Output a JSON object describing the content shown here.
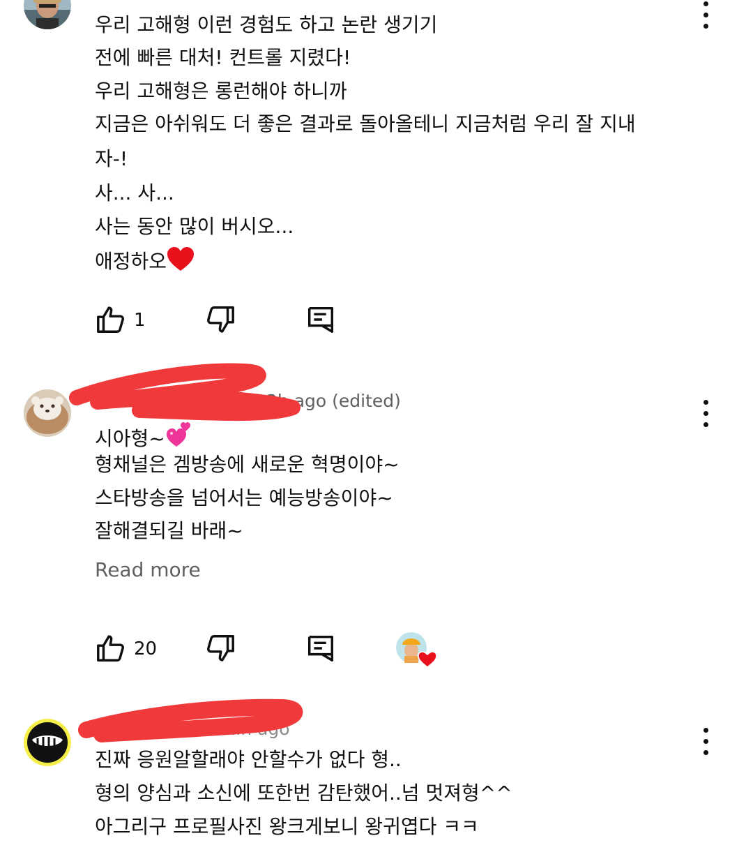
{
  "comments": [
    {
      "meta": "",
      "lines": [
        "우리 고해형 이런 경험도 하고 논란 생기기",
        "전에 빠른 대처! 컨트롤 지렸다!",
        "우리 고해형은 롱런해야 하니까",
        "지금은 아쉬워도 더 좋은 결과로 돌아올테니 지금처럼 우리 잘 지내",
        "자-!",
        "사... 사...",
        "사는 동안 많이 버시오...",
        "애정하오"
      ],
      "likes": "1"
    },
    {
      "meta": "2h ago (edited)",
      "lines": [
        "시아형~",
        "형채널은 겜방송에 새로운 혁명이야~",
        "스타방송을 넘어서는 예능방송이야~",
        "잘해결되길 바래~"
      ],
      "read_more": "Read more",
      "likes": "20"
    },
    {
      "meta": "min ago",
      "lines": [
        "진짜 응원알할래야 안할수가 없다 형..",
        "형의 양심과 소신에 또한번 감탄했어..넘 멋져형^^",
        "아그리구 프로필사진 왕크게보니 왕귀엽다 ㅋㅋ"
      ]
    }
  ],
  "icons": {
    "like": "thumbs-up-icon",
    "dislike": "thumbs-down-icon",
    "reply": "reply-icon",
    "more": "more-vert-icon",
    "heart": "red-heart-emoji",
    "sparkle_heart": "sparkling-heart-emoji"
  },
  "colors": {
    "redaction": "#f0393b",
    "heart": "#e8111c",
    "secondary_text": "#606060"
  }
}
